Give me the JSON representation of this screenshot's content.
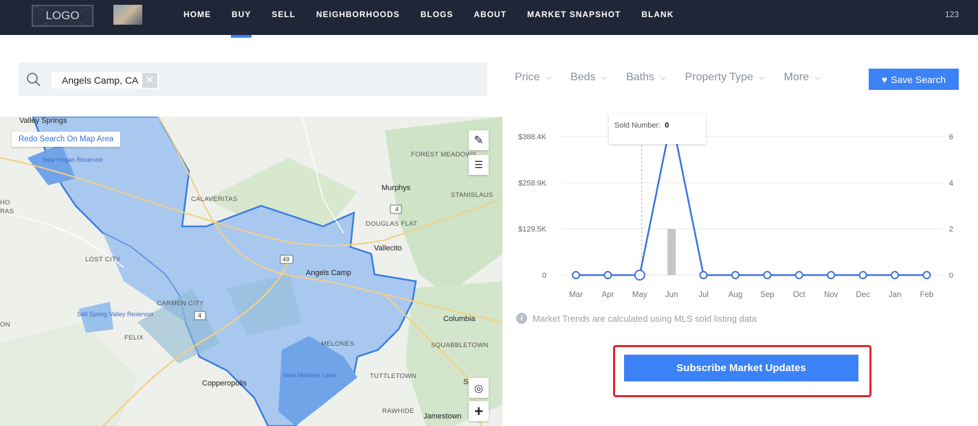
{
  "nav": {
    "logo": "LOGO",
    "items": [
      "HOME",
      "BUY",
      "SELL",
      "NEIGHBORHOODS",
      "BLOGS",
      "ABOUT",
      "MARKET SNAPSHOT",
      "BLANK"
    ],
    "active": "BUY",
    "right_text": "123"
  },
  "search": {
    "chip": "Angels Camp, CA"
  },
  "filters": [
    "Price",
    "Beds",
    "Baths",
    "Property Type",
    "More"
  ],
  "save_search": "Save Search",
  "map": {
    "redo": "Redo Search On Map Area",
    "labels": {
      "valley_springs": "Valley Springs",
      "new_hogan": "New Hogan Reservoir",
      "forest_meadows": "FOREST MEADOWS",
      "murphys": "Murphys",
      "calaveritas": "CALAVERITAS",
      "stanislaus": "STANISLAUS",
      "douglas_flat": "DOUGLAS FLAT",
      "vallecito": "Vallecito",
      "lost_city": "LOST CITY",
      "angels_camp": "Angels Camp",
      "carmen_city": "CARMEN CITY",
      "columbia": "Columbia",
      "salt_spring": "Salt Spring Valley Reservoir",
      "felix": "FELIX",
      "melones": "MELONES",
      "squabbletown": "SQUABBLETOWN",
      "copperopolis": "Copperopolis",
      "new_melones": "New Melones Lake",
      "tuttletown": "TUTTLETOWN",
      "rawhide": "RAWHIDE",
      "jamestown": "Jamestown",
      "left_edge1": "HO",
      "left_edge2": "RAS",
      "left_edge3": "ON",
      "right_edge": "S"
    },
    "shields": [
      "4",
      "49",
      "4"
    ]
  },
  "tooltip": {
    "label": "Sold Number:",
    "value": "0"
  },
  "chart_data": {
    "type": "line",
    "categories": [
      "Mar",
      "Apr",
      "May",
      "Jun",
      "Jul",
      "Aug",
      "Sep",
      "Oct",
      "Nov",
      "Dec",
      "Jan",
      "Feb"
    ],
    "y_left_ticks": [
      "$388.4K",
      "$258.9K",
      "$129.5K",
      "0"
    ],
    "y_right_ticks": [
      "6",
      "4",
      "2",
      "0"
    ],
    "y_left_max": 388400,
    "y_right_max": 6,
    "series": [
      {
        "kind": "line",
        "axis": "right",
        "color": "#3b72e0",
        "values": [
          0,
          0,
          0,
          6.8,
          0,
          0,
          0,
          0,
          0,
          0,
          0,
          0
        ]
      },
      {
        "kind": "bar",
        "axis": "left",
        "color": "#c2c5cc",
        "values": [
          0,
          0,
          0,
          129500,
          0,
          0,
          0,
          0,
          0,
          0,
          0,
          0
        ]
      }
    ],
    "highlight_index": 2,
    "grid": true
  },
  "note": "Market Trends are calculated using MLS sold listing data",
  "subscribe": "Subscribe Market Updates"
}
